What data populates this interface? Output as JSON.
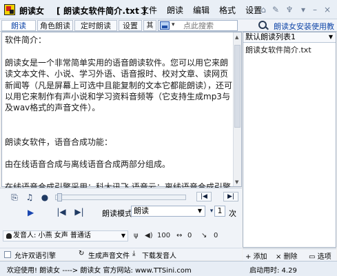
{
  "app": {
    "title": "朗读女",
    "file_title": "[ 朗读女软件简介.txt ]"
  },
  "menu": [
    "文件",
    "朗读",
    "编辑",
    "格式",
    "设置"
  ],
  "tabs": [
    "朗读",
    "角色朗读",
    "定时朗读",
    "设置",
    "其他"
  ],
  "search": {
    "placeholder": "点此搜索"
  },
  "tutorial_link": "朗读女安装使用教程",
  "editor": {
    "text": "软件简介：\n\n朗读女是一个非常简单实用的语音朗读软件。您可以用它来朗读文本文件、小说、学习外语、语音报时、校对文章、读网页新闻等（凡是屏幕上可选中且能复制的文本它都能朗读），还可以用它来制作有声小说和学习资料音频等（它支持生成mp3与及wav格式的声音文件）。\n\n\n朗读女软件，语音合成功能：\n\n由在线语音合成与离线语音合成两部分组成。\n\n在线语音合成引擎采用：科大讯飞.语音云；离线语音合成引擎采用：微软TTS语音合成引擎。"
  },
  "playlist": {
    "selected": "默认朗读列表1",
    "items": [
      "朗读女软件简介.txt"
    ]
  },
  "side_actions": {
    "add": "+ 添加",
    "delete": "× 删除",
    "options": "▭ 选项"
  },
  "playback": {
    "mode_label": "朗读模式:",
    "mode_value": "朗读",
    "times_value": "1",
    "times_suffix": "次"
  },
  "speaker": {
    "label": "发音人: 小燕 女声 普通话",
    "volume": "100",
    "speed": "0",
    "pitch": "0"
  },
  "actions": {
    "allow_bilingual": "允许双语引擎",
    "generate_audio": "生成声音文件",
    "download_voice": "下载发音人"
  },
  "status": {
    "welcome": "欢迎使用!  朗读女    ---->  朗读女 官方网站: www.TTSini.com",
    "clock": "启动用时: 4.29"
  }
}
